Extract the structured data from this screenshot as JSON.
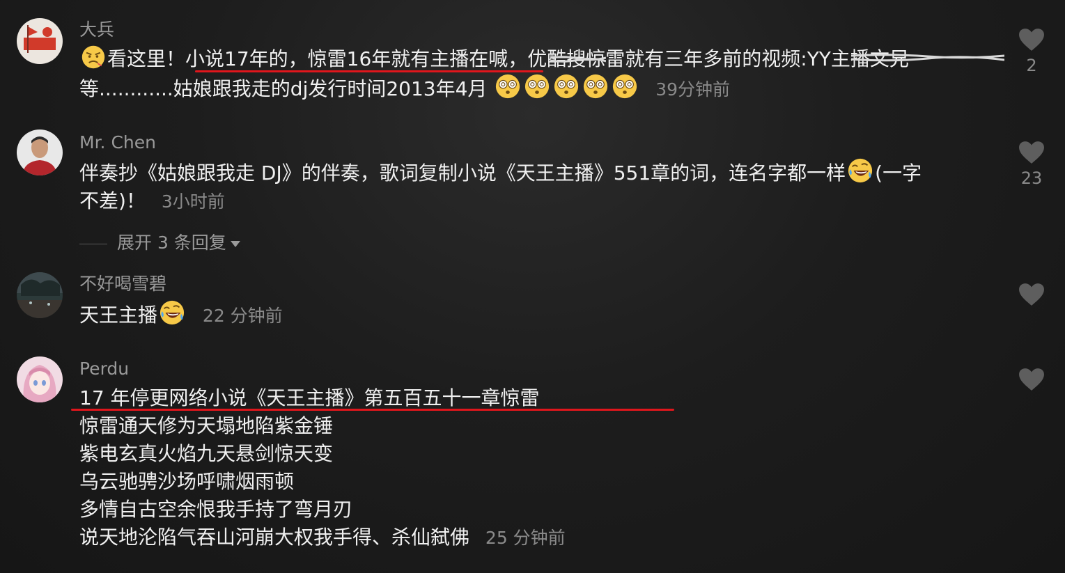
{
  "comments": [
    {
      "username": "大兵",
      "line1": "看这里！小说17年的，惊雷16年就有主播在喊，优酷搜惊雷就有三年多前的视频:YY主播文兄",
      "line2": "等............姑娘跟我走的dj发行时间2013年4月",
      "time": "39分钟前",
      "likes": "2"
    },
    {
      "username": "Mr. Chen",
      "line1": "伴奏抄《姑娘跟我走 DJ》的伴奏，歌词复制小说《天王主播》551章的词，连名字都一样",
      "line1b": "(一字",
      "line2": "不差)！",
      "time": "3小时前",
      "likes": "23",
      "replies": "展开 3 条回复"
    },
    {
      "username": "不好喝雪碧",
      "line1": "天王主播",
      "time": "22 分钟前"
    },
    {
      "username": "Perdu",
      "lines": [
        "17 年停更网络小说《天王主播》第五百五十一章惊雷",
        "惊雷通天修为天塌地陷紫金锤",
        "紫电玄真火焰九天悬剑惊天变",
        "乌云驰骋沙场呼啸烟雨顿",
        "多情自古空余恨我手持了弯月刃",
        "说天地沦陷气吞山河崩大权我手得、杀仙弑佛"
      ],
      "time": "25 分钟前"
    }
  ],
  "colors": {
    "background": "#1d1d1d",
    "text": "#f0f0f0",
    "meta": "#8a8a8a",
    "annotation": "#e0161c"
  },
  "icons": {
    "like": "heart-icon",
    "expand": "caret-down-icon",
    "emoji_angry": "angry-face-emoji",
    "emoji_dizzy": "dizzy-face-emoji",
    "emoji_laugh": "rofl-emoji"
  }
}
